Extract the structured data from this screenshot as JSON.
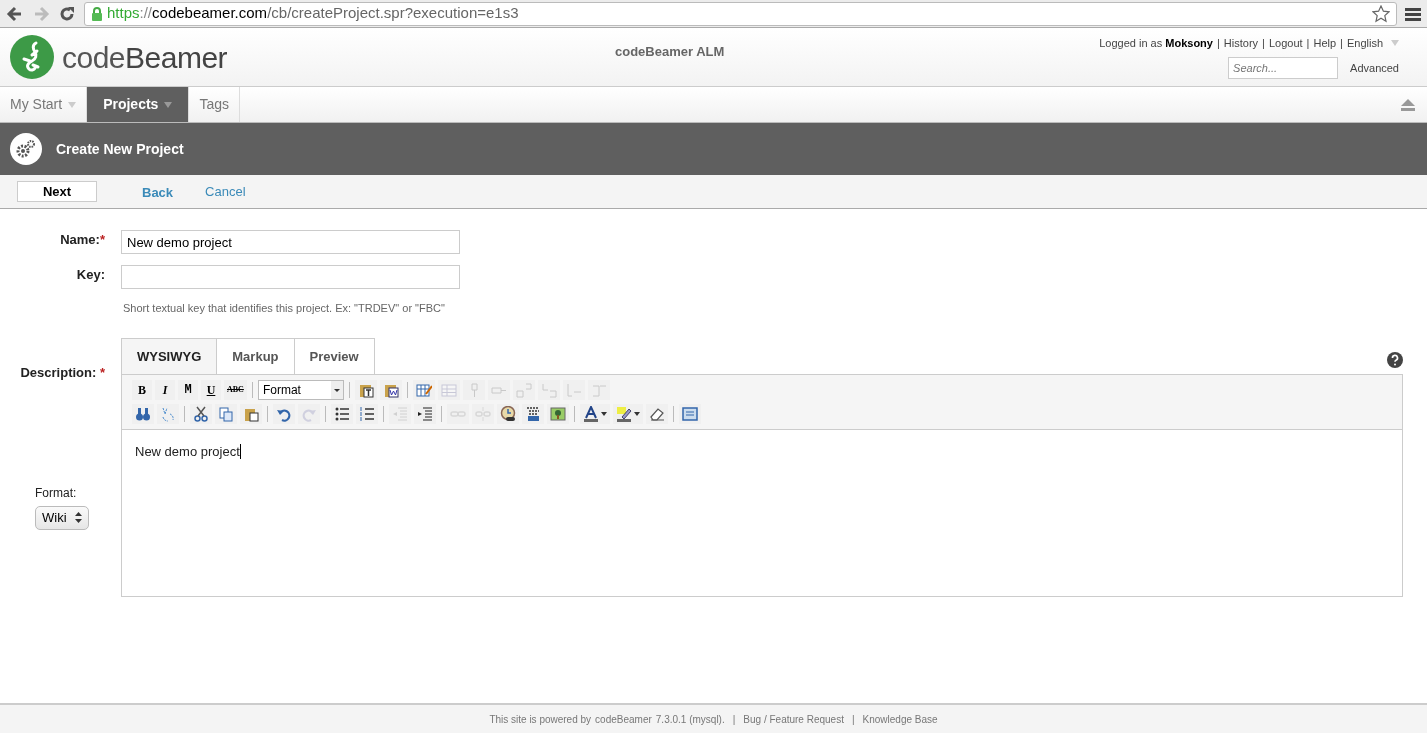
{
  "browser": {
    "forward_disabled": true,
    "url_scheme": "https",
    "url_sep": "://",
    "url_domain": "codebeamer.com",
    "url_path": "/cb/createProject.spr?execution=e1s3"
  },
  "header": {
    "logo_text": "code**Beamer**",
    "app_title": "codeBeamer ALM",
    "user_links": [
      {
        "kind": "text",
        "text": "Logged in as **Moksony**"
      },
      {
        "kind": "sep",
        "text": "|"
      },
      {
        "kind": "link",
        "text": "History"
      },
      {
        "kind": "sep",
        "text": "|"
      },
      {
        "kind": "link",
        "text": "Logout"
      },
      {
        "kind": "sep",
        "text": "|"
      },
      {
        "kind": "link",
        "text": "Help"
      },
      {
        "kind": "sep",
        "text": "|"
      },
      {
        "kind": "menu",
        "text": "English"
      }
    ],
    "search": {
      "placeholder": "Search..."
    },
    "advanced": "Advanced"
  },
  "tabs": [
    {
      "label": "My Start",
      "menu": true,
      "selected": false
    },
    {
      "label": "Projects",
      "menu": true,
      "selected": true
    },
    {
      "label": "Tags",
      "menu": false,
      "selected": false
    }
  ],
  "page_title": "Create New Project",
  "actions": [
    {
      "kind": "button",
      "text": "Next"
    },
    {
      "kind": "bold-link",
      "text": "Back"
    },
    {
      "kind": "link",
      "text": "Cancel"
    }
  ],
  "form": {
    "name": {
      "label": "Name:",
      "mark": "*",
      "value": "New demo project"
    },
    "key": {
      "label": "Key:",
      "hint": "Short textual key that identifies this project. Ex: \"TRDEV\" or \"FBC\""
    },
    "description": {
      "label": "Description:",
      "mark": "*",
      "editor_tabs": [
        {
          "label": "WYSIWYG",
          "selected": true
        },
        {
          "label": "Markup",
          "selected": false
        },
        {
          "label": "Preview",
          "selected": false
        }
      ],
      "toolbar": [
        [
          {
            "kind": "text",
            "label": "B"
          },
          {
            "kind": "text",
            "label": "I"
          },
          {
            "kind": "text",
            "label": "M"
          },
          {
            "kind": "text",
            "label": "U"
          },
          {
            "kind": "text",
            "label": "ABC"
          },
          {
            "kind": "sep"
          },
          {
            "kind": "select",
            "value": "Format"
          },
          {
            "kind": "sep"
          },
          {
            "kind": "icon",
            "disabled": false
          },
          {
            "kind": "icon",
            "disabled": false
          },
          {
            "kind": "sep"
          },
          {
            "kind": "icon",
            "disabled": false
          },
          {
            "kind": "icon",
            "disabled": true
          },
          {
            "kind": "icon",
            "disabled": true
          },
          {
            "kind": "icon",
            "disabled": true
          },
          {
            "kind": "icon",
            "disabled": true
          },
          {
            "kind": "icon",
            "disabled": true
          },
          {
            "kind": "icon",
            "disabled": true
          },
          {
            "kind": "icon",
            "disabled": true
          }
        ],
        [
          {
            "kind": "icon",
            "disabled": false
          },
          {
            "kind": "icon",
            "disabled": false
          },
          {
            "kind": "sep"
          },
          {
            "kind": "icon",
            "disabled": false
          },
          {
            "kind": "icon",
            "disabled": false
          },
          {
            "kind": "icon",
            "disabled": false
          },
          {
            "kind": "sep"
          },
          {
            "kind": "icon",
            "disabled": false
          },
          {
            "kind": "icon",
            "disabled": true
          },
          {
            "kind": "sep"
          },
          {
            "kind": "icon",
            "disabled": false
          },
          {
            "kind": "icon",
            "disabled": false
          },
          {
            "kind": "sep"
          },
          {
            "kind": "icon",
            "disabled": true
          },
          {
            "kind": "icon",
            "disabled": false
          },
          {
            "kind": "sep"
          },
          {
            "kind": "icon",
            "disabled": true
          },
          {
            "kind": "icon",
            "disabled": true
          },
          {
            "kind": "icon",
            "disabled": false
          },
          {
            "kind": "icon",
            "disabled": false
          },
          {
            "kind": "icon",
            "disabled": false
          },
          {
            "kind": "sep"
          },
          {
            "kind": "icon",
            "disabled": false,
            "dropdown": true
          },
          {
            "kind": "icon",
            "disabled": false,
            "dropdown": true
          },
          {
            "kind": "icon",
            "disabled": false
          },
          {
            "kind": "sep"
          },
          {
            "kind": "icon",
            "disabled": false
          }
        ]
      ],
      "content": "New demo project"
    },
    "format": {
      "label": "Format:",
      "value": "Wiki"
    }
  },
  "footer": [
    {
      "kind": "text",
      "text": "This site is powered by"
    },
    {
      "kind": "link",
      "text": "codeBeamer"
    },
    {
      "kind": "text",
      "text": "7.3.0.1 (mysql)."
    },
    {
      "kind": "sep",
      "text": "|"
    },
    {
      "kind": "link",
      "text": "Bug / Feature Request"
    },
    {
      "kind": "sep",
      "text": "|"
    },
    {
      "kind": "link",
      "text": "Knowledge Base"
    }
  ]
}
